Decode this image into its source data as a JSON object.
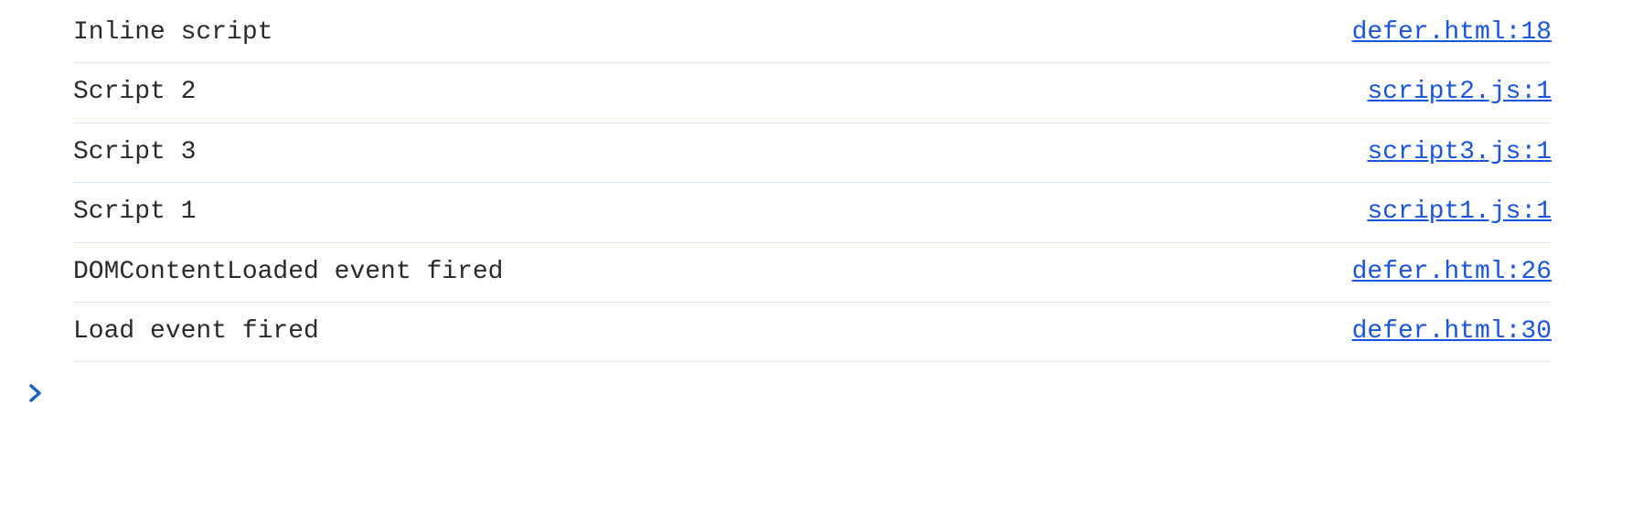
{
  "console": {
    "entries": [
      {
        "message": "Inline script",
        "source": "defer.html:18"
      },
      {
        "message": "Script 2",
        "source": "script2.js:1"
      },
      {
        "message": "Script 3",
        "source": "script3.js:1"
      },
      {
        "message": "Script 1",
        "source": "script1.js:1"
      },
      {
        "message": "DOMContentLoaded event fired",
        "source": "defer.html:26"
      },
      {
        "message": "Load event fired",
        "source": "defer.html:30"
      }
    ],
    "prompt": "❯"
  }
}
